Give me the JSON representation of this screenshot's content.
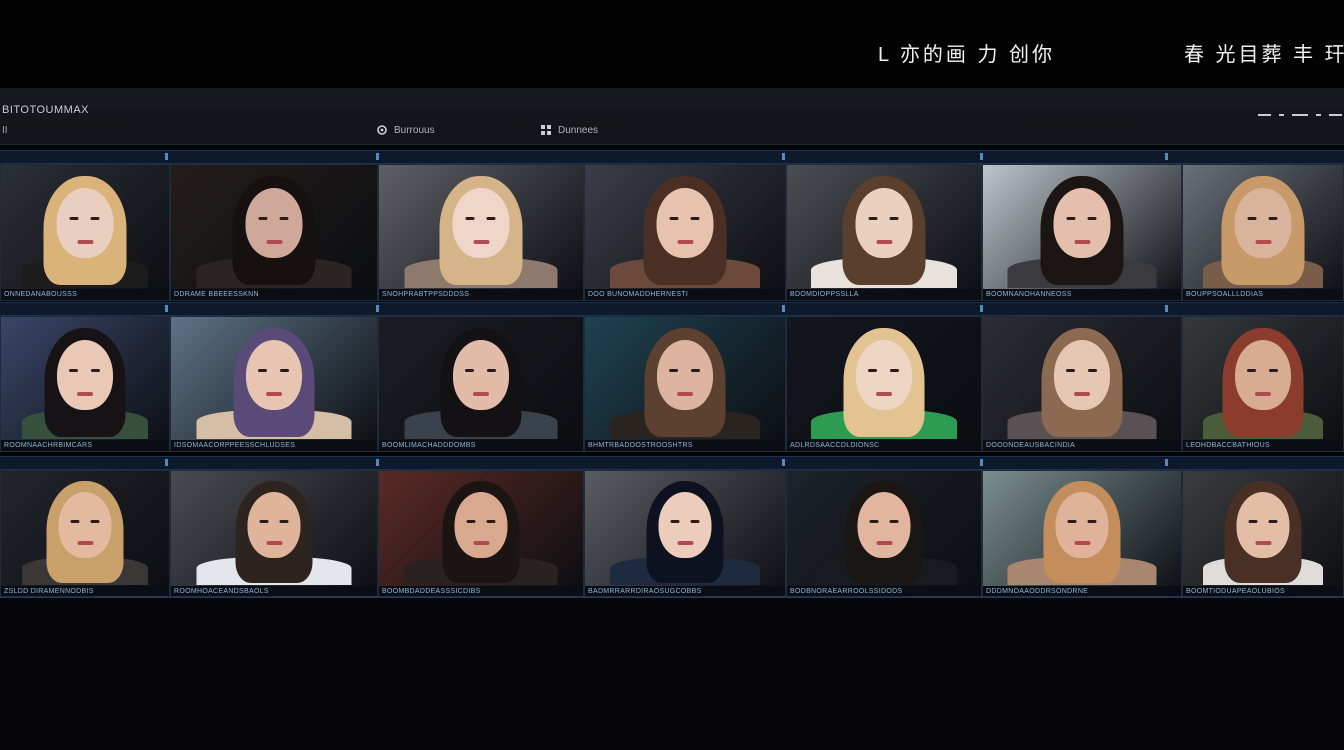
{
  "top": {
    "title": "L 亦的画 力 创你",
    "title_right": "春 光目葬 丰 玕"
  },
  "app": {
    "name": "BITOTOUMMAX",
    "sub": "II",
    "toolbar": [
      {
        "label": "Burrouus",
        "icon": "gear-icon"
      },
      {
        "label": "Dunnees",
        "icon": "grid-icon"
      }
    ]
  },
  "grid": {
    "rows": [
      {
        "tiles": [
          {
            "label": "ONNEDANABOUSSS",
            "skin": "#e8cfc0",
            "hair": "#d9b37a",
            "bg": "#2b2f36",
            "body": "#1c1c1c"
          },
          {
            "label": "DDRAME BBEEESSKNN",
            "skin": "#cfa899",
            "hair": "#16110f",
            "bg": "#231d1a",
            "body": "#2c2422"
          },
          {
            "label": "SNOHPRABTPPSDDDSS",
            "skin": "#f0d6c8",
            "hair": "#d6b48a",
            "bg": "#5e6066",
            "body": "#8e7a6c"
          },
          {
            "label": "DOO BUNOMADDHERNESTI",
            "skin": "#e7c2ae",
            "hair": "#4b2f24",
            "bg": "#3a3d47",
            "body": "#6b4a3b"
          },
          {
            "label": "BDOMDIOPPSSLLA",
            "skin": "#ecd0bf",
            "hair": "#5a3f2d",
            "bg": "#4a4d52",
            "body": "#e9e1dc"
          },
          {
            "label": "BOOMNANOHANNEOSS",
            "skin": "#e5bfae",
            "hair": "#1b1513",
            "bg": "#bdc4cc",
            "body": "#3b3a3e"
          },
          {
            "label": "BOUPPSOALLLDDIAS",
            "skin": "#d9b49d",
            "hair": "#c89a6a",
            "bg": "#6a7079",
            "body": "#7a5d48"
          }
        ]
      },
      {
        "tiles": [
          {
            "label": "ROOMNAACHRBIMCARS",
            "skin": "#e9c8b6",
            "hair": "#171215",
            "bg": "#3a4668",
            "body": "#36503d"
          },
          {
            "label": "IDSOMAACORPPEESSCHLUDSES",
            "skin": "#e7c5b2",
            "hair": "#5a4a78",
            "bg": "#5d7386",
            "body": "#d5bea6"
          },
          {
            "label": "BOOMLIMACHADDDOMBS",
            "skin": "#e2bca9",
            "hair": "#141114",
            "bg": "#1b1d22",
            "body": "#39424d"
          },
          {
            "label": "BHMTRBADOOSTROOSHTRS",
            "skin": "#dcb49f",
            "hair": "#5c4030",
            "bg": "#1f4252",
            "body": "#2a2420"
          },
          {
            "label": "ADLRDSAACCDLDIONSC",
            "skin": "#efd5c4",
            "hair": "#e2c391",
            "bg": "#13161d",
            "body": "#2d9c52"
          },
          {
            "label": "DOODNOEAUSBACINDIA",
            "skin": "#e6c7b4",
            "hair": "#8c6a52",
            "bg": "#2c2c33",
            "body": "#5a5154"
          },
          {
            "label": "LEOHDBACCBATHIOUS",
            "skin": "#d8ab93",
            "hair": "#8b3c2d",
            "bg": "#34393b",
            "body": "#4a5c3a"
          }
        ]
      },
      {
        "tiles": [
          {
            "label": "ZSLDD DIRAMENNODBIS",
            "skin": "#e3b99f",
            "hair": "#c9a06a",
            "bg": "#22252c",
            "body": "#3a3736"
          },
          {
            "label": "ROOMHOACEANDSBAOLS",
            "skin": "#dfb49b",
            "hair": "#2d2420",
            "bg": "#4a4b52",
            "body": "#e3e6ea"
          },
          {
            "label": "BOOMBDADDEASSSICDIBS",
            "skin": "#d8a98f",
            "hair": "#1a1413",
            "bg": "#5b2a25",
            "body": "#2a2220"
          },
          {
            "label": "BADMRRARRDIRAOSUGCOBBS",
            "skin": "#ecccbb",
            "hair": "#0e1220",
            "bg": "#5a5d64",
            "body": "#1e2a40"
          },
          {
            "label": "BODBNORAEARROOLSSIDODS",
            "skin": "#e1b59e",
            "hair": "#1a1614",
            "bg": "#1d232a",
            "body": "#171a1f"
          },
          {
            "label": "DDDMNOAAODDRSONDRNE",
            "skin": "#e0b29a",
            "hair": "#c48e5c",
            "bg": "#7b8e8f",
            "body": "#a98670"
          },
          {
            "label": "BOOMTIODUAPEAOLUBIOS",
            "skin": "#e3bda6",
            "hair": "#4a3024",
            "bg": "#3a3c3e",
            "body": "#dfdcda"
          }
        ]
      }
    ]
  }
}
